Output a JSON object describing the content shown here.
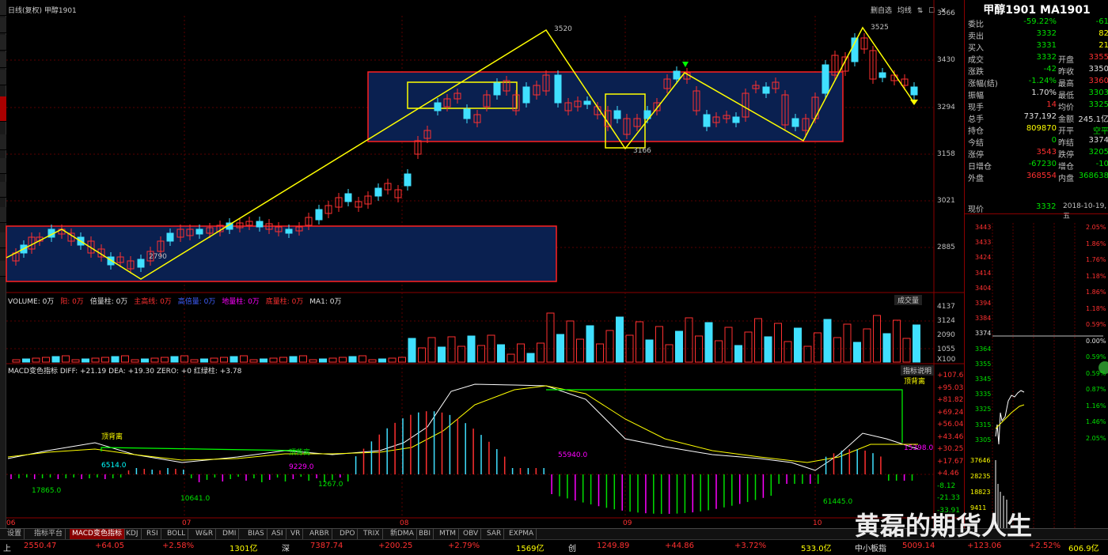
{
  "header": {
    "left_title": "日线(复权)  甲醇1901",
    "right_buttons": [
      "删自选",
      "均线",
      "⇅",
      "☐",
      "✕"
    ]
  },
  "price_scale": [
    "3566",
    "3430",
    "3294",
    "3158",
    "3021",
    "2885"
  ],
  "annotations": {
    "high1": "3520",
    "high2": "3525",
    "low1": "2790",
    "low2": "3166"
  },
  "volume_panel": {
    "header_items": [
      {
        "label": "VOLUME: 0万",
        "color": "#e0e0e0"
      },
      {
        "label": "阳: 0万",
        "color": "#ff3030"
      },
      {
        "label": "倍量柱: 0万",
        "color": "#e0e0e0"
      },
      {
        "label": "主高线: 0万",
        "color": "#ff3030"
      },
      {
        "label": "高倍量: 0万",
        "color": "#4060ff"
      },
      {
        "label": "地量柱: 0万",
        "color": "#ff00ff"
      },
      {
        "label": "底量柱: 0万",
        "color": "#ff3030"
      },
      {
        "label": "MA1: 0万",
        "color": "#e0e0e0"
      }
    ],
    "button": "成交量",
    "scale": [
      "4137",
      "3124",
      "2090",
      "1055",
      "X100"
    ]
  },
  "macd_panel": {
    "header": "MACD变色指标  DIFF: +21.19  DEA: +19.30  ZERO: +0  红绿柱: +3.78",
    "button": "指标说明",
    "scale": [
      "+107.6",
      "+95.03",
      "+81.82",
      "+69.24",
      "+56.04",
      "+43.46",
      "+30.25",
      "+17.67",
      "+4.46",
      "-8.12",
      "-21.33",
      "-33.91"
    ],
    "labels": {
      "top_div_1": "顶背离",
      "top_div_2": "顶背离",
      "top_div_3": "顶背离",
      "v1": "6514.0",
      "v2": "17865.0",
      "v3": "10641.0",
      "v4": "9229.0",
      "v5": "1267.0",
      "v6": "55940.0",
      "v7": "61445.0",
      "v8": "15398.0"
    }
  },
  "months": [
    "06",
    "07",
    "08",
    "09",
    "10"
  ],
  "quote": {
    "title": "甲醇1901  MA1901",
    "rows": [
      {
        "a": "委比",
        "b": "-59.22%",
        "bc": "green",
        "d": "-61",
        "dc": "green"
      },
      {
        "a": "卖出",
        "b": "3332",
        "bc": "green",
        "d": "82",
        "dc": "yel"
      },
      {
        "a": "买入",
        "b": "3331",
        "bc": "green",
        "d": "21",
        "dc": "yel"
      },
      {
        "a": "成交",
        "b": "3332",
        "bc": "green",
        "c": "开盘",
        "d": "3355",
        "dc": "red"
      },
      {
        "a": "涨跌",
        "b": "-42",
        "bc": "green",
        "c": "昨收",
        "d": "3350",
        "dc": "wht"
      },
      {
        "a": "涨幅(结)",
        "b": "-1.24%",
        "bc": "green",
        "c": "最高",
        "d": "3360",
        "dc": "red"
      },
      {
        "a": "振幅",
        "b": "1.70%",
        "bc": "wht",
        "c": "最低",
        "d": "3303",
        "dc": "green"
      },
      {
        "a": "现手",
        "b": "14",
        "bc": "red",
        "c": "均价",
        "d": "3325",
        "dc": "green"
      },
      {
        "a": "总手",
        "b": "737,192",
        "bc": "wht",
        "c": "金额",
        "d": "245.1亿",
        "dc": "wht"
      },
      {
        "a": "持仓",
        "b": "809870",
        "bc": "yel",
        "c": "开平",
        "d": "空平",
        "dc": "green"
      },
      {
        "a": "今结",
        "b": "0",
        "bc": "green",
        "c": "昨结",
        "d": "3374",
        "dc": "wht"
      },
      {
        "a": "涨停",
        "b": "3543",
        "bc": "red",
        "c": "跌停",
        "d": "3205",
        "dc": "green"
      },
      {
        "a": "日增仓",
        "b": "-67230",
        "bc": "green",
        "c": "增仓",
        "d": "-10",
        "dc": "green"
      },
      {
        "a": "外盘",
        "b": "368554",
        "bc": "red",
        "c": "内盘",
        "d": "368638",
        "dc": "green"
      }
    ],
    "current_label": "现价",
    "current_value": "3332",
    "date": "2018-10-19,五"
  },
  "mini_chart": {
    "left_scale": [
      "3443",
      "3433",
      "3424",
      "3414",
      "3404",
      "3394",
      "3384",
      "3374",
      "3364",
      "3355",
      "3345",
      "3335",
      "3325",
      "3315",
      "3305"
    ],
    "right_scale": [
      "2.05%",
      "1.86%",
      "1.76%",
      "1.18%",
      "1.86%",
      "1.18%",
      "0.59%",
      "0.00%",
      "0.59%",
      "0.59%",
      "0.87%",
      "1.16%",
      "1.46%",
      "2.05%"
    ],
    "vol_scale": [
      "37646",
      "28235",
      "18823",
      "9411"
    ]
  },
  "bottom_tabs": [
    "设置",
    "指标平台",
    "MACD变色指标",
    "KDJ",
    "RSI",
    "BOLL",
    "W&R",
    "DMI",
    "BIAS",
    "ASI",
    "VR",
    "ARBR",
    "DPO",
    "TRIX",
    "新DMA",
    "BBI",
    "MTM",
    "OBV",
    "SAR",
    "EXPMA"
  ],
  "status": {
    "items": [
      {
        "t": "上",
        "c": "wht"
      },
      {
        "t": "2550.47",
        "c": "red"
      },
      {
        "t": "+64.05",
        "c": "red"
      },
      {
        "t": "+2.58%",
        "c": "red"
      },
      {
        "t": "1301亿",
        "c": "yel"
      },
      {
        "t": "深",
        "c": "wht"
      },
      {
        "t": "7387.74",
        "c": "red"
      },
      {
        "t": "+200.25",
        "c": "red"
      },
      {
        "t": "+2.79%",
        "c": "red"
      },
      {
        "t": "1569亿",
        "c": "yel"
      },
      {
        "t": "创",
        "c": "wht"
      },
      {
        "t": "1249.89",
        "c": "red"
      },
      {
        "t": "+44.86",
        "c": "red"
      },
      {
        "t": "+3.72%",
        "c": "red"
      },
      {
        "t": "533.0亿",
        "c": "yel"
      },
      {
        "t": "中小板指",
        "c": "wht"
      },
      {
        "t": "5009.14",
        "c": "red"
      },
      {
        "t": "+123.06",
        "c": "red"
      },
      {
        "t": "+2.52%",
        "c": "red"
      },
      {
        "t": "606.9亿",
        "c": "yel"
      }
    ]
  },
  "watermark": "黄磊的期货人生"
}
